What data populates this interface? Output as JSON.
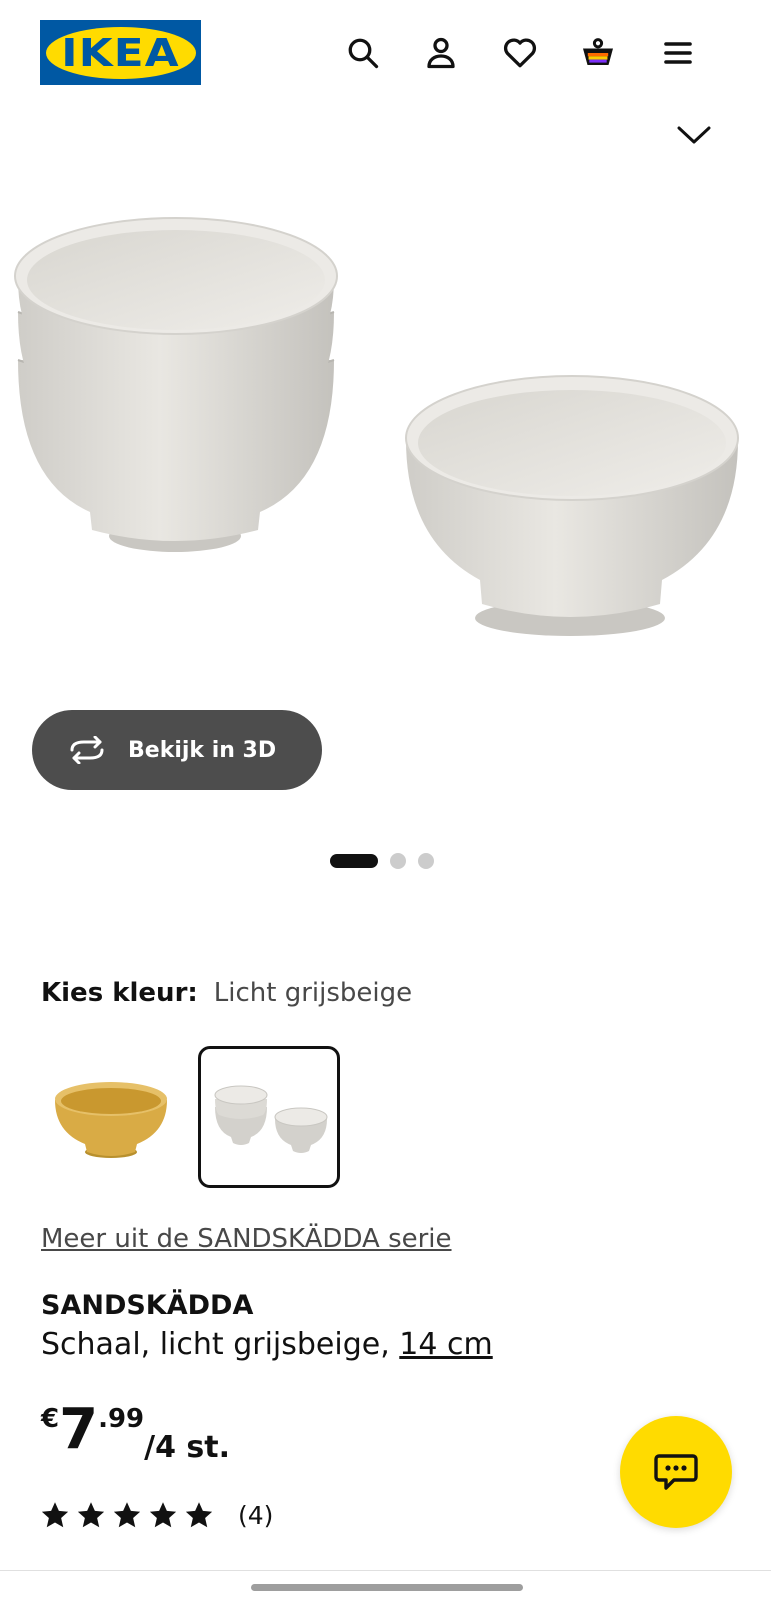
{
  "header": {
    "logo_text": "IKEA",
    "icons": [
      "search-icon",
      "user-icon",
      "heart-icon",
      "shopping-bag-icon",
      "menu-icon"
    ]
  },
  "colors": {
    "brand_blue": "#0058a3",
    "brand_yellow": "#ffdb00",
    "button_gray": "#4d4d4d",
    "text": "#111111"
  },
  "viewer": {
    "button_3d_label": "Bekijk in 3D",
    "carousel_total": 3,
    "carousel_active": 1
  },
  "color_picker": {
    "label": "Kies kleur:",
    "selected_value": "Licht grijsbeige",
    "options": [
      "yellow-bowl",
      "light-grey-beige-bowls"
    ]
  },
  "product": {
    "series_link": "Meer uit de SANDSKÄDDA serie",
    "name": "SANDSKÄDDA",
    "description": "Schaal, licht grijsbeige, ",
    "size": "14 cm",
    "price": {
      "currency": "€",
      "integer": "7",
      "decimal": ".99",
      "unit": "/4 st."
    },
    "rating": {
      "stars": 5,
      "count": "(4)"
    }
  }
}
